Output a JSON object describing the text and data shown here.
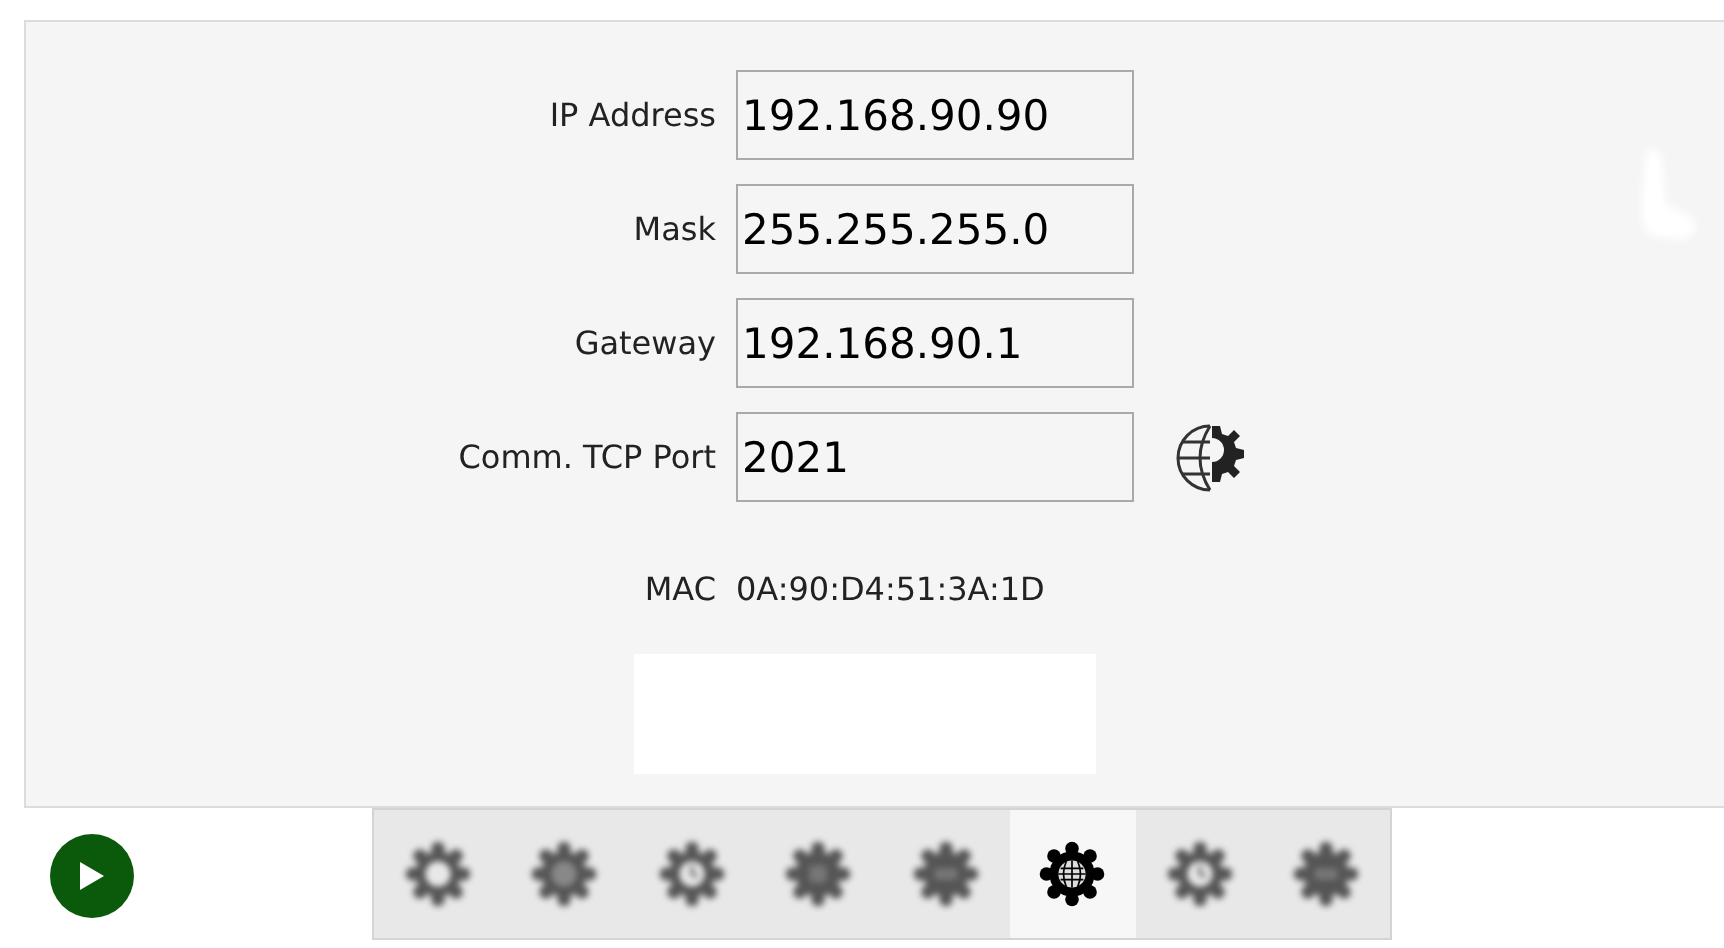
{
  "fields": [
    {
      "label": "IP Address",
      "value": "192.168.90.90"
    },
    {
      "label": "Mask",
      "value": "255.255.255.0"
    },
    {
      "label": "Gateway",
      "value": "192.168.90.1"
    },
    {
      "label": "Comm. TCP Port",
      "value": "2021"
    }
  ],
  "mac": {
    "label": "MAC",
    "value": "0A:90:D4:51:3A:1D"
  },
  "tabs": [
    {
      "kind": "ring",
      "selected": false
    },
    {
      "kind": "disc",
      "selected": false
    },
    {
      "kind": "clock",
      "selected": false
    },
    {
      "kind": "chip",
      "selected": false
    },
    {
      "kind": "display",
      "selected": false
    },
    {
      "kind": "globe",
      "selected": true
    },
    {
      "kind": "clock",
      "selected": false
    },
    {
      "kind": "display",
      "selected": false
    }
  ]
}
